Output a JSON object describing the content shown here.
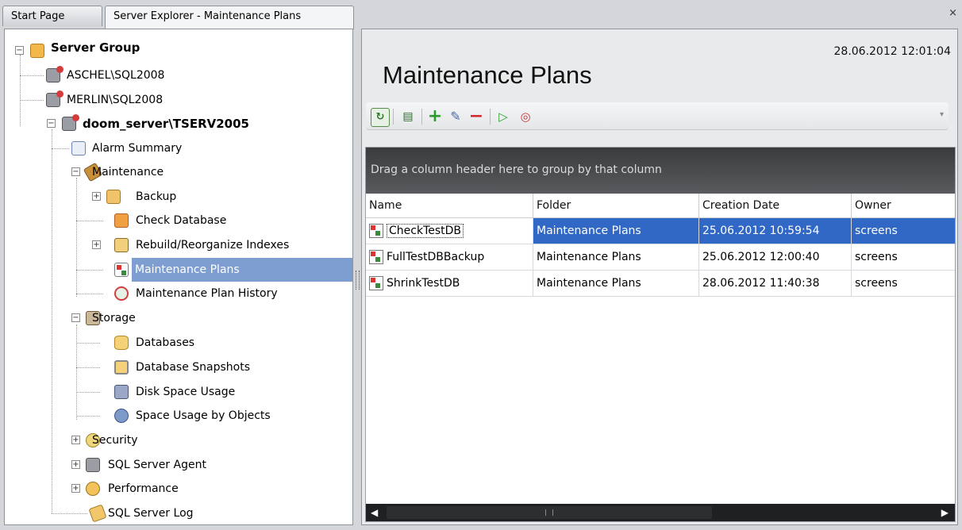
{
  "tabs": [
    {
      "label": "Start Page",
      "active": false
    },
    {
      "label": "Server Explorer - Maintenance Plans",
      "active": true
    }
  ],
  "close_symbol": "×",
  "tree": {
    "server_group": "Server Group",
    "servers": [
      "ASCHEL\\SQL2008",
      "MERLIN\\SQL2008",
      "doom_server\\TSERV2005"
    ],
    "items": {
      "alarm_summary": "Alarm Summary",
      "maintenance": "Maintenance",
      "backup": "Backup",
      "check_database": "Check Database",
      "rebuild_indexes": "Rebuild/Reorganize Indexes",
      "maintenance_plans": "Maintenance Plans",
      "maintenance_plan_history": "Maintenance Plan History",
      "storage": "Storage",
      "databases": "Databases",
      "database_snapshots": "Database Snapshots",
      "disk_space_usage": "Disk Space Usage",
      "space_usage_by_objects": "Space Usage by Objects",
      "security": "Security",
      "sql_server_agent": "SQL Server Agent",
      "performance": "Performance",
      "sql_server_log": "SQL Server Log"
    },
    "selected": "Maintenance Plans"
  },
  "main": {
    "title": "Maintenance Plans",
    "datetime": "28.06.2012 12:01:04",
    "toolbar_icons": [
      "refresh-icon",
      "properties-icon",
      "add-icon",
      "edit-icon",
      "remove-icon",
      "run-icon",
      "history-icon"
    ]
  },
  "grid": {
    "group_hint": "Drag a column header here to group by that column",
    "columns": [
      "Name",
      "Folder",
      "Creation Date",
      "Owner"
    ],
    "rows": [
      {
        "name": "CheckTestDB",
        "folder": "Maintenance Plans",
        "date": "25.06.2012 10:59:54",
        "owner": "screens"
      },
      {
        "name": "FullTestDBBackup",
        "folder": "Maintenance Plans",
        "date": "25.06.2012 12:00:40",
        "owner": "screens"
      },
      {
        "name": "ShrinkTestDB",
        "folder": "Maintenance Plans",
        "date": "28.06.2012 11:40:38",
        "owner": "screens"
      }
    ],
    "selected_row": 0
  },
  "colors": {
    "selection": "#3167c5",
    "tree_selection": "#7e9ed1",
    "group_panel": "#3a3b3d"
  }
}
